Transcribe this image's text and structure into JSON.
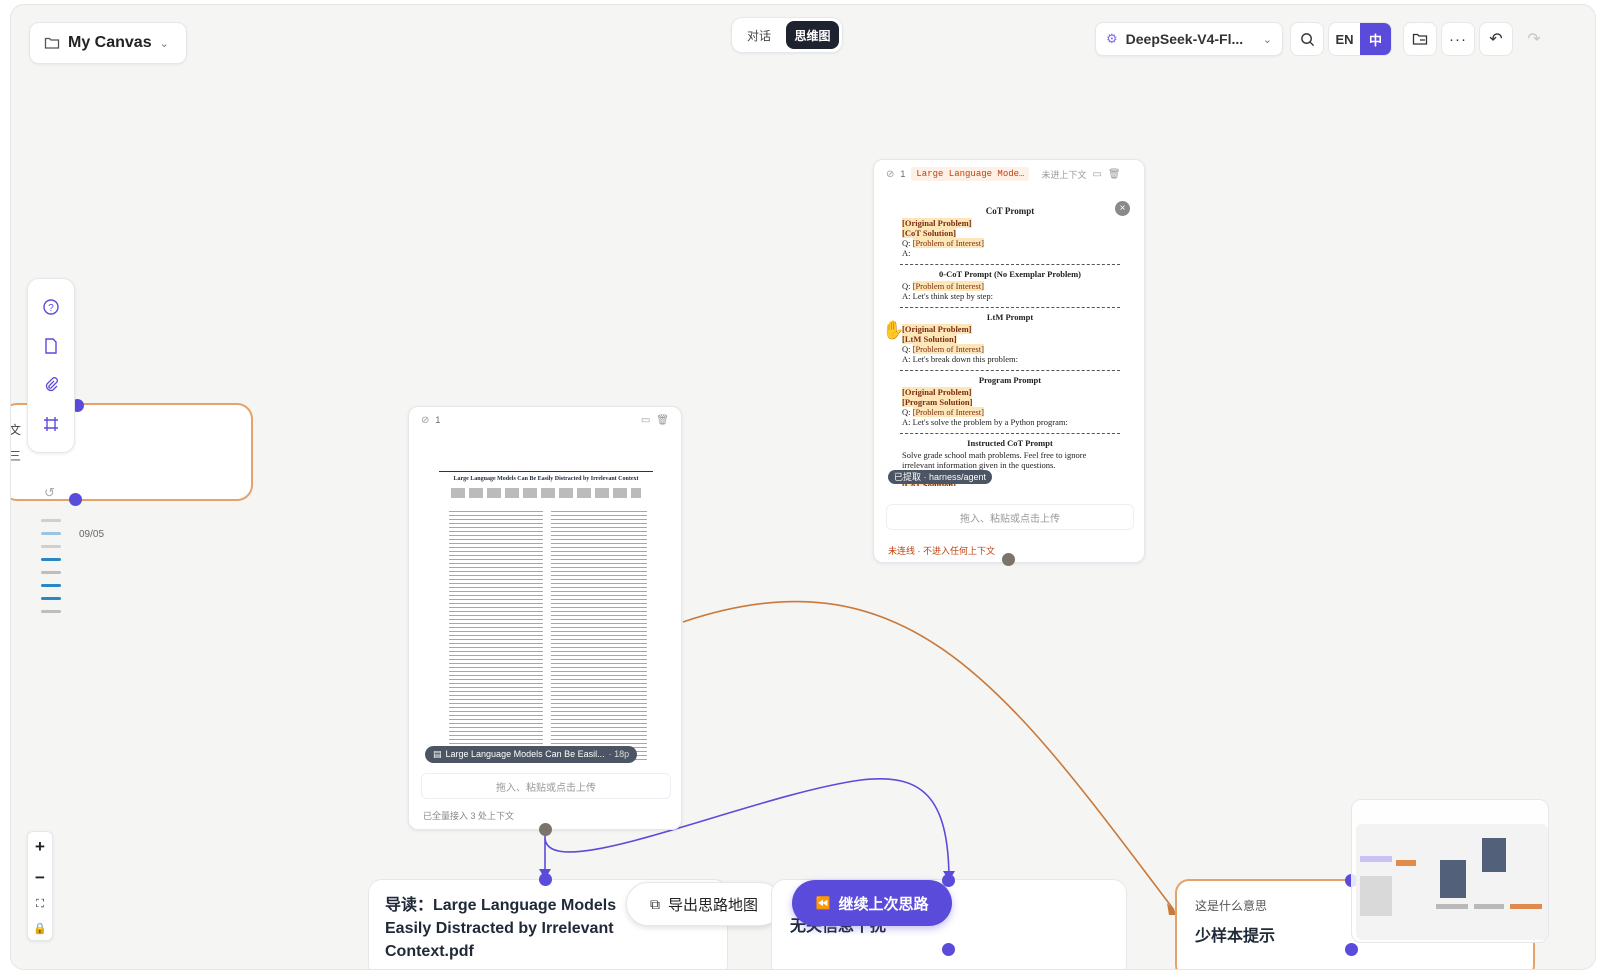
{
  "canvas_menu": {
    "label": "My Canvas"
  },
  "view_toggle": {
    "chat": "对话",
    "mindmap": "思维图",
    "active": "mindmap"
  },
  "model_select": {
    "label": "DeepSeek-V4-Fl..."
  },
  "lang": {
    "en": "EN",
    "zh": "中",
    "active": "zh"
  },
  "left_toolbar": {
    "icons": [
      "help-icon",
      "document-icon",
      "paperclip-icon",
      "frame-icon"
    ]
  },
  "left_node": {
    "fragments": [
      "文",
      "三"
    ]
  },
  "history": {
    "date": "09/05"
  },
  "cot_card": {
    "attach_count": "1",
    "title": "Large Language Mode…",
    "status_badge": "未进上下文",
    "image_title": "CoT Prompt",
    "tag": "已提取 · harness/agent",
    "drop_hint": "拖入、粘贴或点击上传",
    "footer": "未连线 · 不进入任何上下文",
    "lines": {
      "orig1": "[Original Problem]",
      "cot1": "[CoT Solution]",
      "q1": "Q: ",
      "poi": "[Problem of Interest]",
      "a1": "A:",
      "h2": "0-CoT Prompt (No Exemplar Problem)",
      "a2": "A: Let's think step by step:",
      "h3": "LtM Prompt",
      "ltm_sol": "[LtM Solution]",
      "a3": "A: Let's break down this problem:",
      "h4": "Program Prompt",
      "prog_sol": "[Program Solution]",
      "a4": "A: Let's solve the problem by a Python program:",
      "h5": "Instructed CoT Prompt",
      "instr": "Solve grade school math problems. Feel free to ignore irrelevant information given in the questions."
    }
  },
  "pdf_card": {
    "attach_count": "1",
    "paper_title": "Large Language Models Can Be Easily Distracted by Irrelevant Context",
    "file_chip": "Large Language Models Can Be Easil...",
    "pages": "· 18p",
    "drop_hint": "拖入、粘贴或点击上传",
    "footer": "已全量接入 3 处上下文"
  },
  "bottom_nodes": {
    "guide_title": "导读：Large Language Models Easily Distracted by Irrelevant Context.pdf",
    "export_button": "导出思路地图",
    "continue_button": "继续上次思路",
    "middle_node": "无关信息干扰",
    "right_question": "这是什么意思",
    "right_answer": "少样本提示"
  },
  "zoom_controls": {
    "plus": "+",
    "minus": "−"
  },
  "colors": {
    "accent": "#5b4bdb",
    "edge_orange": "#c9793a",
    "node_orange": "#e3a36a"
  }
}
